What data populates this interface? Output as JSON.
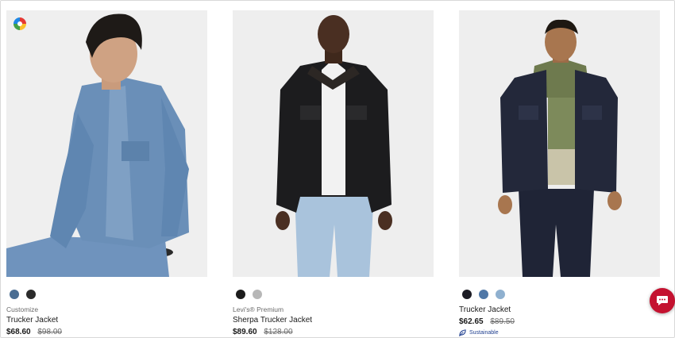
{
  "products": [
    {
      "eyebrow": "Customize",
      "name": "Trucker Jacket",
      "price_now": "$68.60",
      "price_was": "$98.00",
      "swatches": [
        "#4a6d92",
        "#2b2b2b"
      ],
      "badge_icon": "customize-color-wheel-icon"
    },
    {
      "eyebrow": "Levi's® Premium",
      "name": "Sherpa Trucker Jacket",
      "price_now": "$89.60",
      "price_was": "$128.00",
      "swatches": [
        "#1c1c1c",
        "#b7b7b7"
      ]
    },
    {
      "eyebrow": "",
      "name": "Trucker Jacket",
      "price_now": "$62.65",
      "price_was": "$89.50",
      "swatches": [
        "#1c1c24",
        "#4f77a6",
        "#8fb0cf"
      ],
      "tag": "Sustainable",
      "tag_icon": "leaf-icon"
    }
  ],
  "chat": {
    "icon": "chat-bubble-icon",
    "color": "#c41230"
  }
}
